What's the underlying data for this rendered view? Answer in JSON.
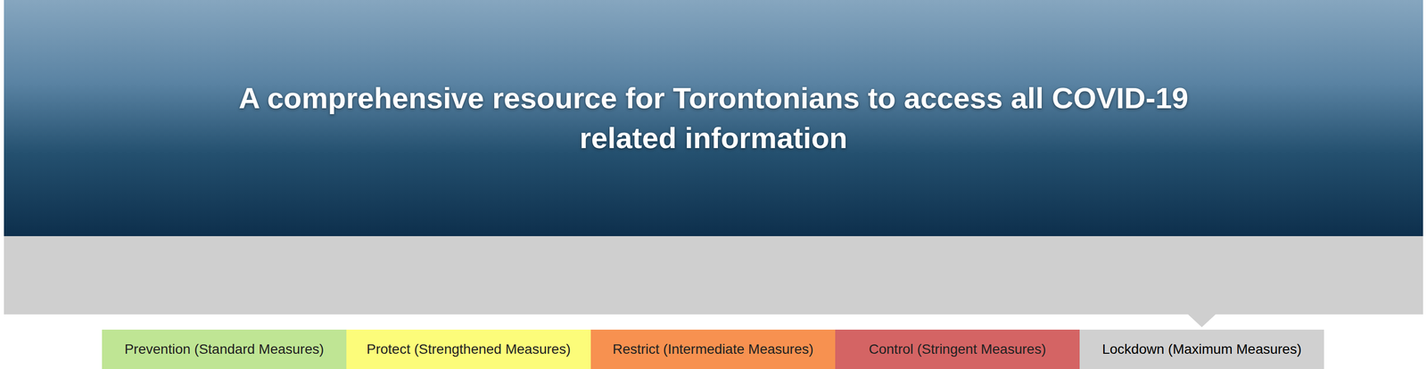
{
  "hero": {
    "heading": "A comprehensive resource for Torontonians to access all COVID-19 related information"
  },
  "tabs": [
    {
      "label": "Prevention (Standard Measures)",
      "selected": false,
      "color": "#bfe594"
    },
    {
      "label": "Protect (Strengthened Measures)",
      "selected": false,
      "color": "#fcfc7a"
    },
    {
      "label": "Restrict (Intermediate Measures)",
      "selected": false,
      "color": "#f79150"
    },
    {
      "label": "Control (Stringent Measures)",
      "selected": false,
      "color": "#d46464"
    },
    {
      "label": "Lockdown (Maximum Measures)",
      "selected": true,
      "color": "#d0d0d0"
    }
  ]
}
